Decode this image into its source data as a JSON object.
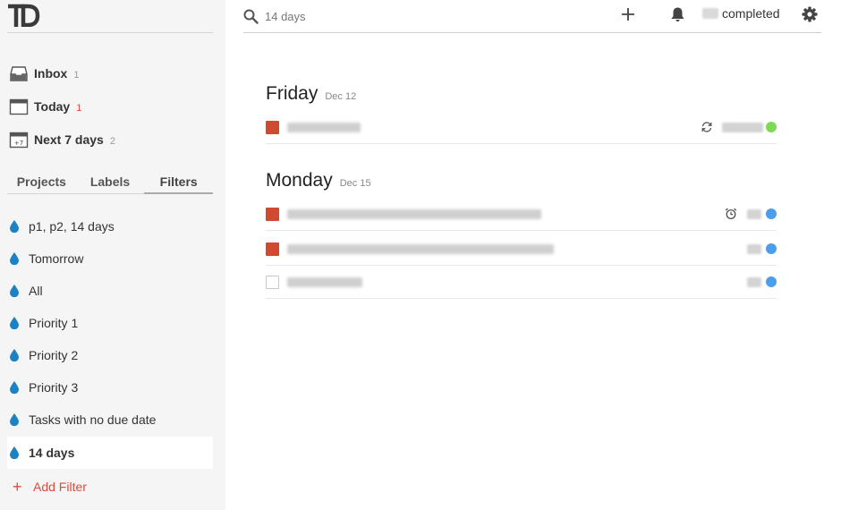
{
  "app": {
    "logo_text": "TD"
  },
  "sidebar": {
    "nav": [
      {
        "label": "Inbox",
        "count": "1",
        "icon": "inbox-icon"
      },
      {
        "label": "Today",
        "count": "1",
        "icon": "calendar-today-icon"
      },
      {
        "label": "Next 7 days",
        "count": "2",
        "icon": "calendar-week-icon",
        "badge": "+7"
      }
    ],
    "tabs": [
      {
        "label": "Projects"
      },
      {
        "label": "Labels"
      },
      {
        "label": "Filters",
        "active": true
      }
    ],
    "filters": [
      {
        "label": "p1, p2, 14 days"
      },
      {
        "label": "Tomorrow"
      },
      {
        "label": "All"
      },
      {
        "label": "Priority 1"
      },
      {
        "label": "Priority 2"
      },
      {
        "label": "Priority 3"
      },
      {
        "label": "Tasks with no due date"
      },
      {
        "label": "14 days",
        "selected": true
      }
    ],
    "add_filter_label": "Add Filter",
    "filter_drop_color": "#1b82c4"
  },
  "topbar": {
    "search_value": "14 days",
    "completed_label": "completed",
    "icons": [
      "search-icon",
      "plus-icon",
      "bell-icon",
      "gear-icon"
    ]
  },
  "main": {
    "days": [
      {
        "name": "Friday",
        "date": "Dec 12",
        "tasks": [
          {
            "priority_color": "#d1492e",
            "dot_color": "#7ed957",
            "meta_icon": "recurring-icon"
          }
        ]
      },
      {
        "name": "Monday",
        "date": "Dec 15",
        "tasks": [
          {
            "priority_color": "#d1492e",
            "dot_color": "#4a9eea",
            "meta_icon": "alarm-icon"
          },
          {
            "priority_color": "#d1492e",
            "dot_color": "#4a9eea",
            "meta_icon": ""
          },
          {
            "priority_color": "",
            "dot_color": "#4a9eea",
            "meta_icon": ""
          }
        ]
      }
    ]
  },
  "colors": {
    "accent_red": "#dd4b39",
    "sidebar_bg": "#f5f5f5"
  }
}
